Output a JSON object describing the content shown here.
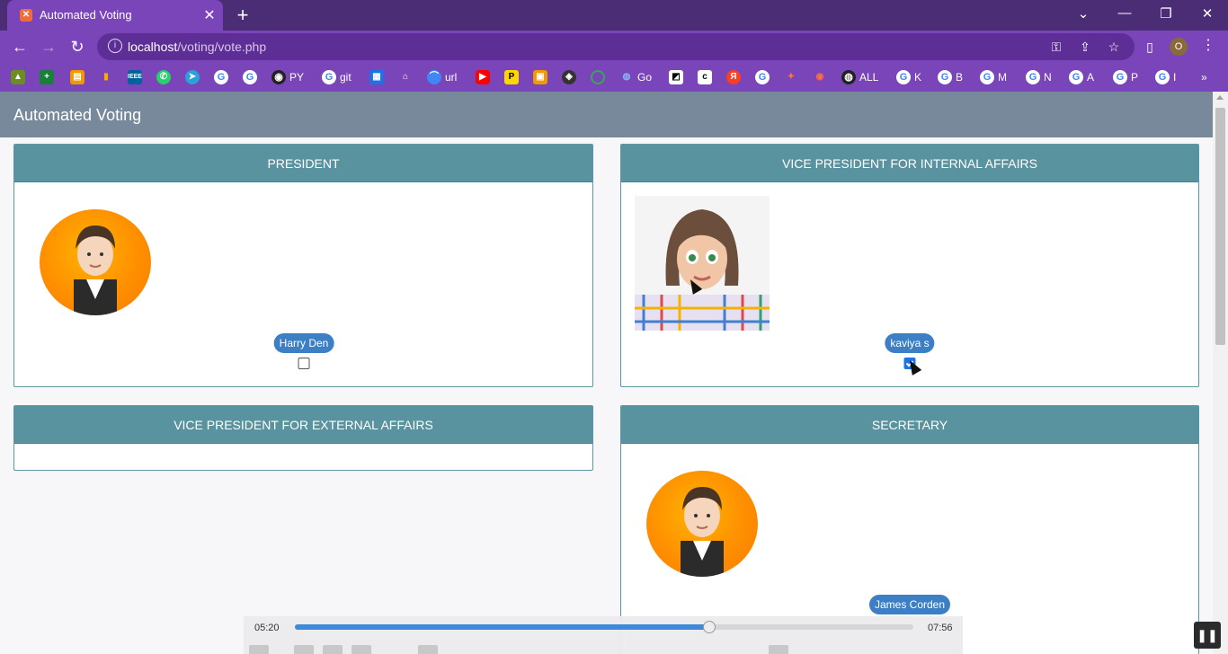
{
  "browser": {
    "tab_title": "Automated Voting",
    "url_host": "localhost",
    "url_path": "/voting/vote.php",
    "profile_initial": "O",
    "bookmarks": [
      "PY",
      "git",
      "url",
      "Go",
      "ALL",
      "K",
      "B",
      "M",
      "N",
      "A",
      "P",
      "I"
    ]
  },
  "app": {
    "title": "Automated Voting"
  },
  "positions": [
    {
      "title": "PRESIDENT",
      "candidate": "Harry Den",
      "checked": false
    },
    {
      "title": "VICE PRESIDENT FOR INTERNAL AFFAIRS",
      "candidate": "kaviya s",
      "checked": true
    },
    {
      "title": "VICE PRESIDENT FOR EXTERNAL AFFAIRS"
    },
    {
      "title": "SECRETARY",
      "candidate": "James Corden",
      "checked": false
    }
  ],
  "media": {
    "current_time": "05:20",
    "total_time": "07:56",
    "progress": 0.67
  },
  "colors": {
    "chrome": "#7a45b8",
    "header": "#78899c",
    "panel_head": "#5a93a0",
    "badge": "#3c7fc4"
  }
}
